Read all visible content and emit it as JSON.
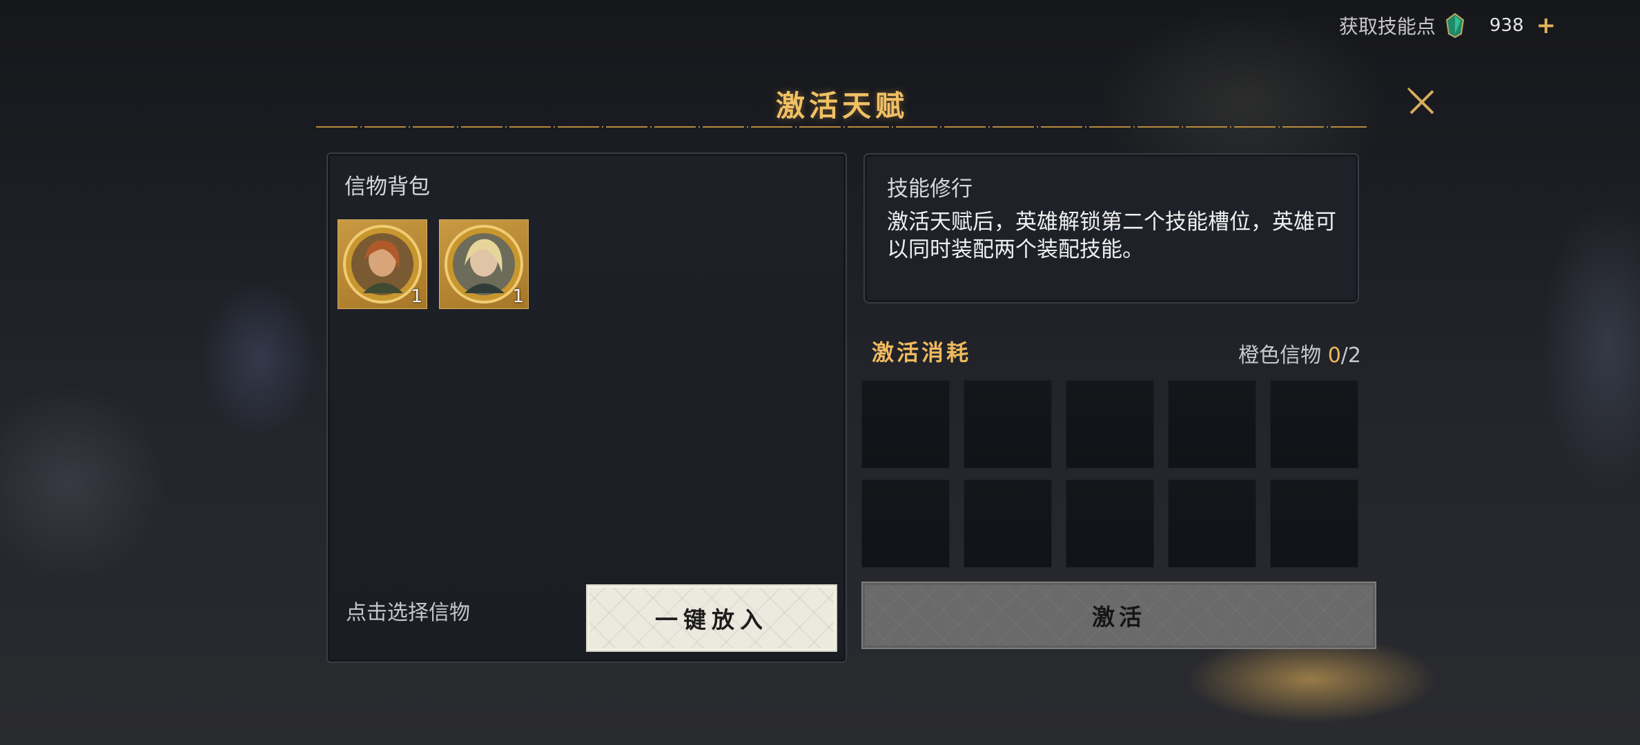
{
  "resource": {
    "label": "获取技能点",
    "count": "938",
    "plus": "+",
    "icon": "green-gem-icon"
  },
  "title": "激活天赋",
  "colors": {
    "accent_gold": "#f0c064",
    "panel_bg": "#1e2028",
    "light_button": "#ece9df",
    "disabled_button": "#6a6a6b"
  },
  "bag": {
    "title": "信物背包",
    "items": [
      {
        "icon": "portrait-coin-icon",
        "quantity": "1"
      },
      {
        "icon": "portrait-coin-icon",
        "quantity": "1"
      }
    ],
    "hint": "点击选择信物",
    "put_all_button": "一键放入"
  },
  "skill": {
    "title": "技能修行",
    "description": "激活天赋后，英雄解锁第二个技能槽位，英雄可以同时装配两个装配技能。"
  },
  "cost": {
    "title": "激活消耗",
    "label": "橙色信物 ",
    "current": "0",
    "total": "/2",
    "slot_count": 10
  },
  "activate_button": "激活"
}
